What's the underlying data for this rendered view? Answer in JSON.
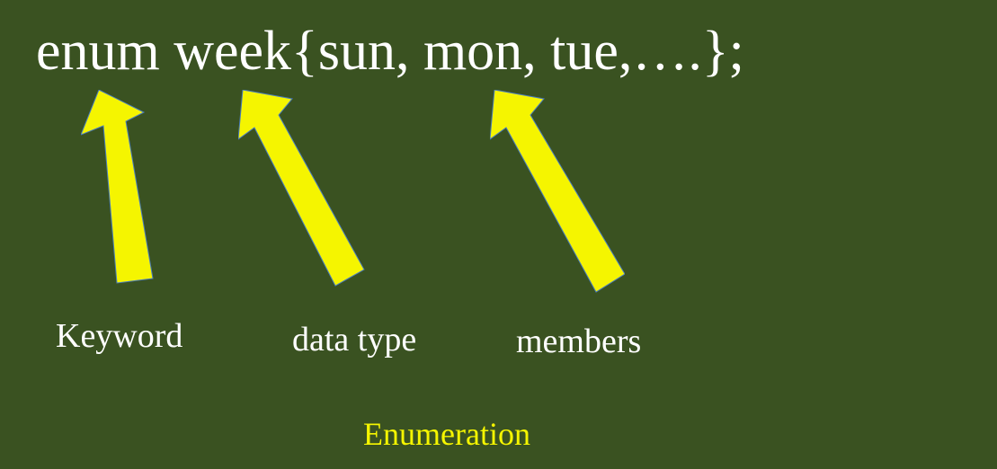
{
  "code_line": "enum week{sun, mon, tue,….};",
  "labels": {
    "keyword": "Keyword",
    "datatype": "data type",
    "members": "members"
  },
  "caption": "Enumeration"
}
